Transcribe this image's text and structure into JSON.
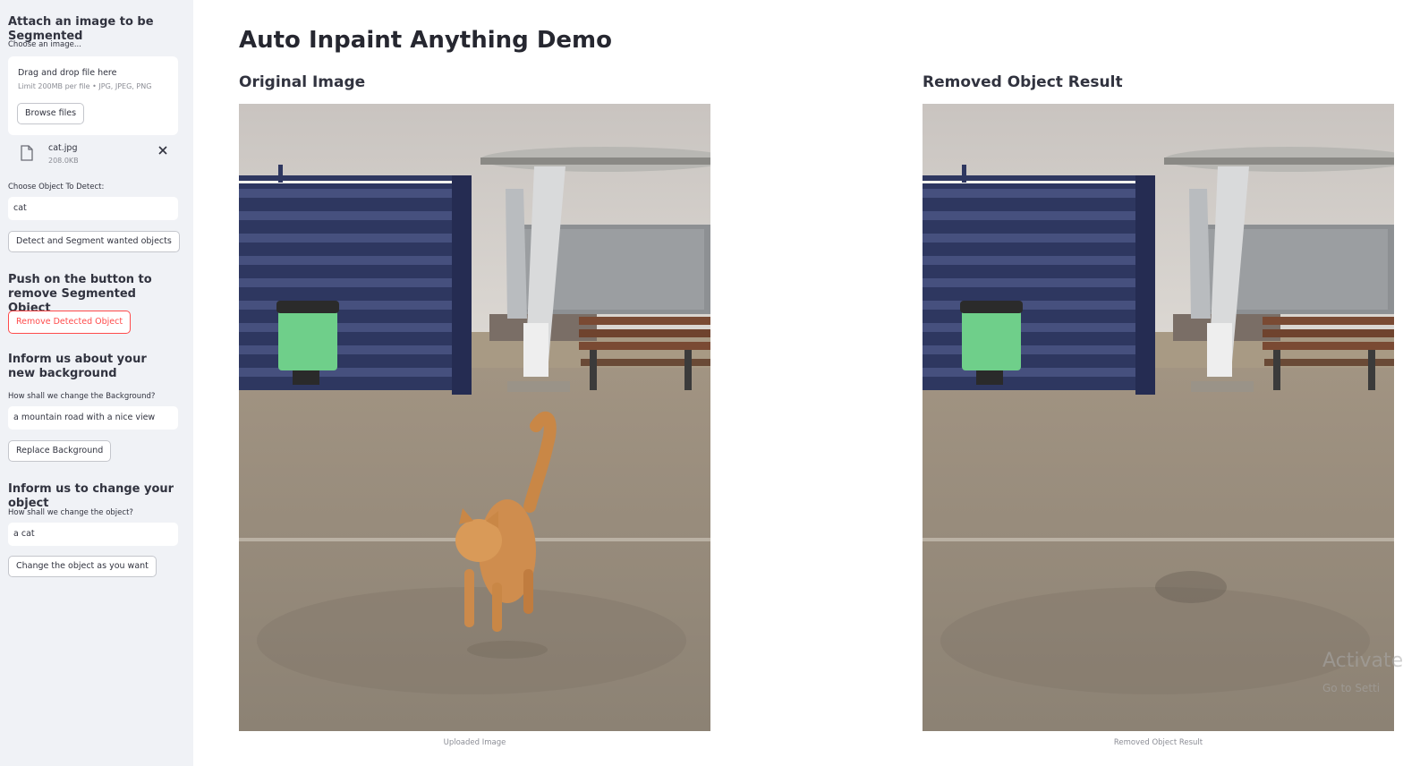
{
  "sidebar": {
    "attach_title": "Attach an image to be Segmented",
    "choose_image_label": "Choose an image...",
    "uploader": {
      "drag_text": "Drag and drop file here",
      "limit_text": "Limit 200MB per file • JPG, JPEG, PNG",
      "browse_label": "Browse files"
    },
    "file": {
      "name": "cat.jpg",
      "size": "208.0KB"
    },
    "object_label": "Choose Object To Detect:",
    "object_value": "cat",
    "detect_button": "Detect and Segment wanted objects",
    "remove_title": "Push on the button to remove Segmented Object",
    "remove_button": "Remove Detected Object",
    "background_title": "Inform us about your new background",
    "background_label": "How shall we change the Background?",
    "background_value": "a mountain road with a nice view",
    "replace_button": "Replace Background",
    "change_title": "Inform us to change your object",
    "change_label": "How shall we change the object?",
    "change_value": "a cat",
    "change_button": "Change the object as you want"
  },
  "main": {
    "title": "Auto Inpaint Anything Demo",
    "original": {
      "title": "Original Image",
      "caption": "Uploaded Image"
    },
    "result": {
      "title": "Removed Object Result",
      "caption": "Removed Object Result"
    }
  },
  "watermark": {
    "line1": "Activate",
    "line2": "Go to Setti"
  },
  "colors": {
    "sidebar_bg": "#f0f2f6",
    "accent": "#ff4b4b",
    "text": "#31333f"
  }
}
